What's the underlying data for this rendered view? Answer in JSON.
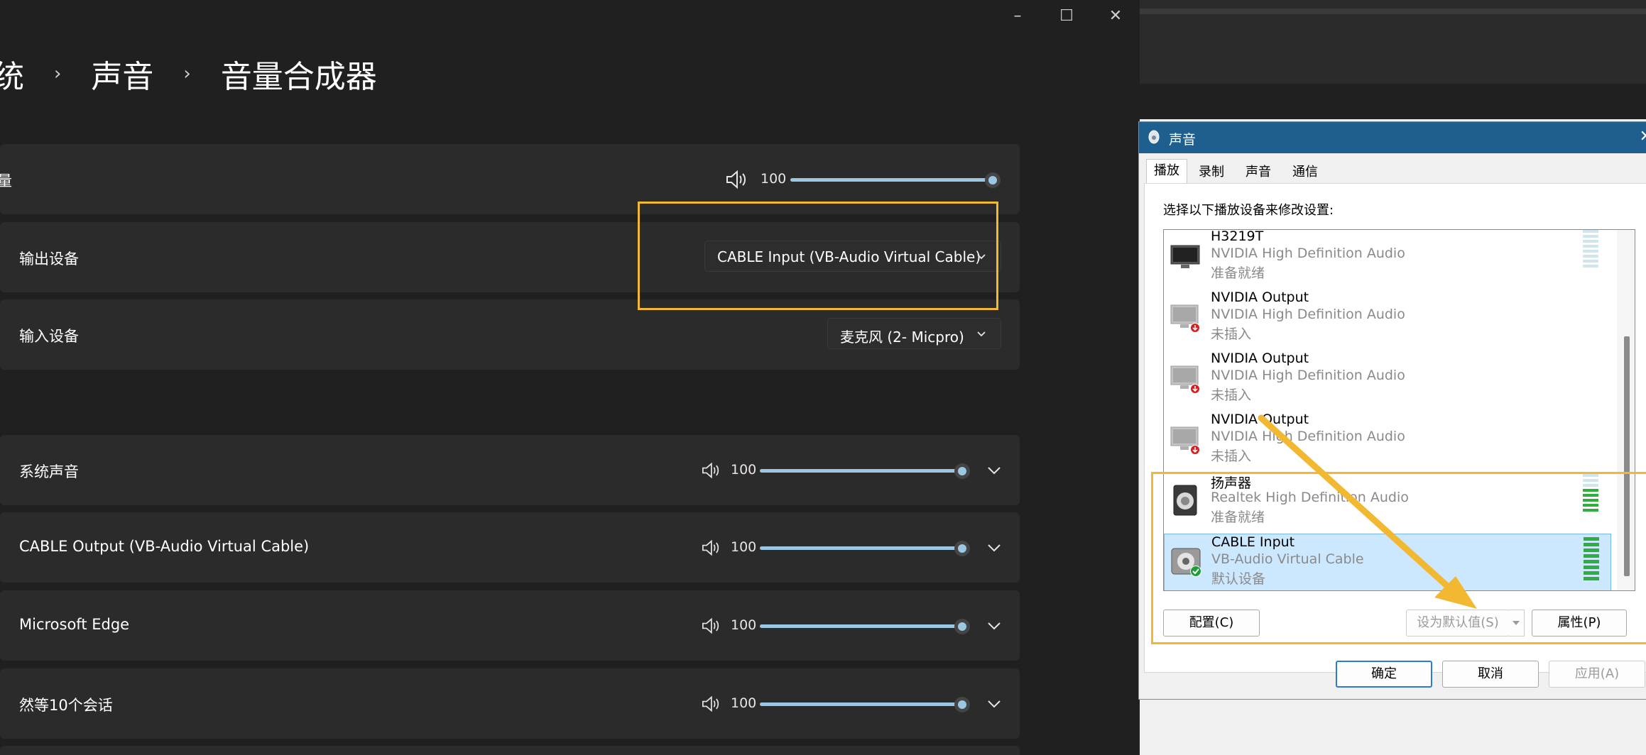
{
  "settings": {
    "breadcrumb": [
      "统",
      "声音",
      "音量合成器"
    ],
    "master": {
      "label": "量",
      "volume": "100",
      "level": 1.0
    },
    "output_device": {
      "label": "输出设备",
      "value": "CABLE Input (VB-Audio Virtual Cable)"
    },
    "input_device": {
      "label": "输入设备",
      "value": "麦克风 (2- Micpro)"
    },
    "apps": [
      {
        "name": "系统声音",
        "volume": "100",
        "level": 1.0
      },
      {
        "name": "CABLE Output (VB-Audio Virtual Cable)",
        "volume": "100",
        "level": 1.0
      },
      {
        "name": "Microsoft Edge",
        "volume": "100",
        "level": 1.0
      },
      {
        "name": "然等10个会话",
        "volume": "100",
        "level": 1.0
      }
    ],
    "accent_color": "#9bc7e3"
  },
  "sound_dialog": {
    "title": "声音",
    "tabs": [
      "播放",
      "录制",
      "声音",
      "通信"
    ],
    "active_tab": "播放",
    "instruction": "选择以下播放设备来修改设置:",
    "devices": [
      {
        "name": "H3219T",
        "desc": "NVIDIA High Definition Audio",
        "state": "准备就绪",
        "icon": "monitor-icon"
      },
      {
        "name": "NVIDIA Output",
        "desc": "NVIDIA High Definition Audio",
        "state": "未插入",
        "icon": "monitor-unplugged-icon"
      },
      {
        "name": "NVIDIA Output",
        "desc": "NVIDIA High Definition Audio",
        "state": "未插入",
        "icon": "monitor-unplugged-icon"
      },
      {
        "name": "NVIDIA Output",
        "desc": "NVIDIA High Definition Audio",
        "state": "未插入",
        "icon": "monitor-unplugged-icon"
      },
      {
        "name": "扬声器",
        "desc": "Realtek High Definition Audio",
        "state": "准备就绪",
        "icon": "speaker-icon"
      },
      {
        "name": "CABLE Input",
        "desc": "VB-Audio Virtual Cable",
        "state": "默认设备",
        "icon": "cable-default-icon",
        "selected": true
      }
    ],
    "buttons": {
      "configure": "配置(C)",
      "set_default": "设为默认值(S)",
      "properties": "属性(P)",
      "ok": "确定",
      "cancel": "取消",
      "apply": "应用(A)"
    },
    "title_color": "#1f5f8f",
    "selected_color": "#cce8ff"
  },
  "highlight_color": "#f2b832"
}
